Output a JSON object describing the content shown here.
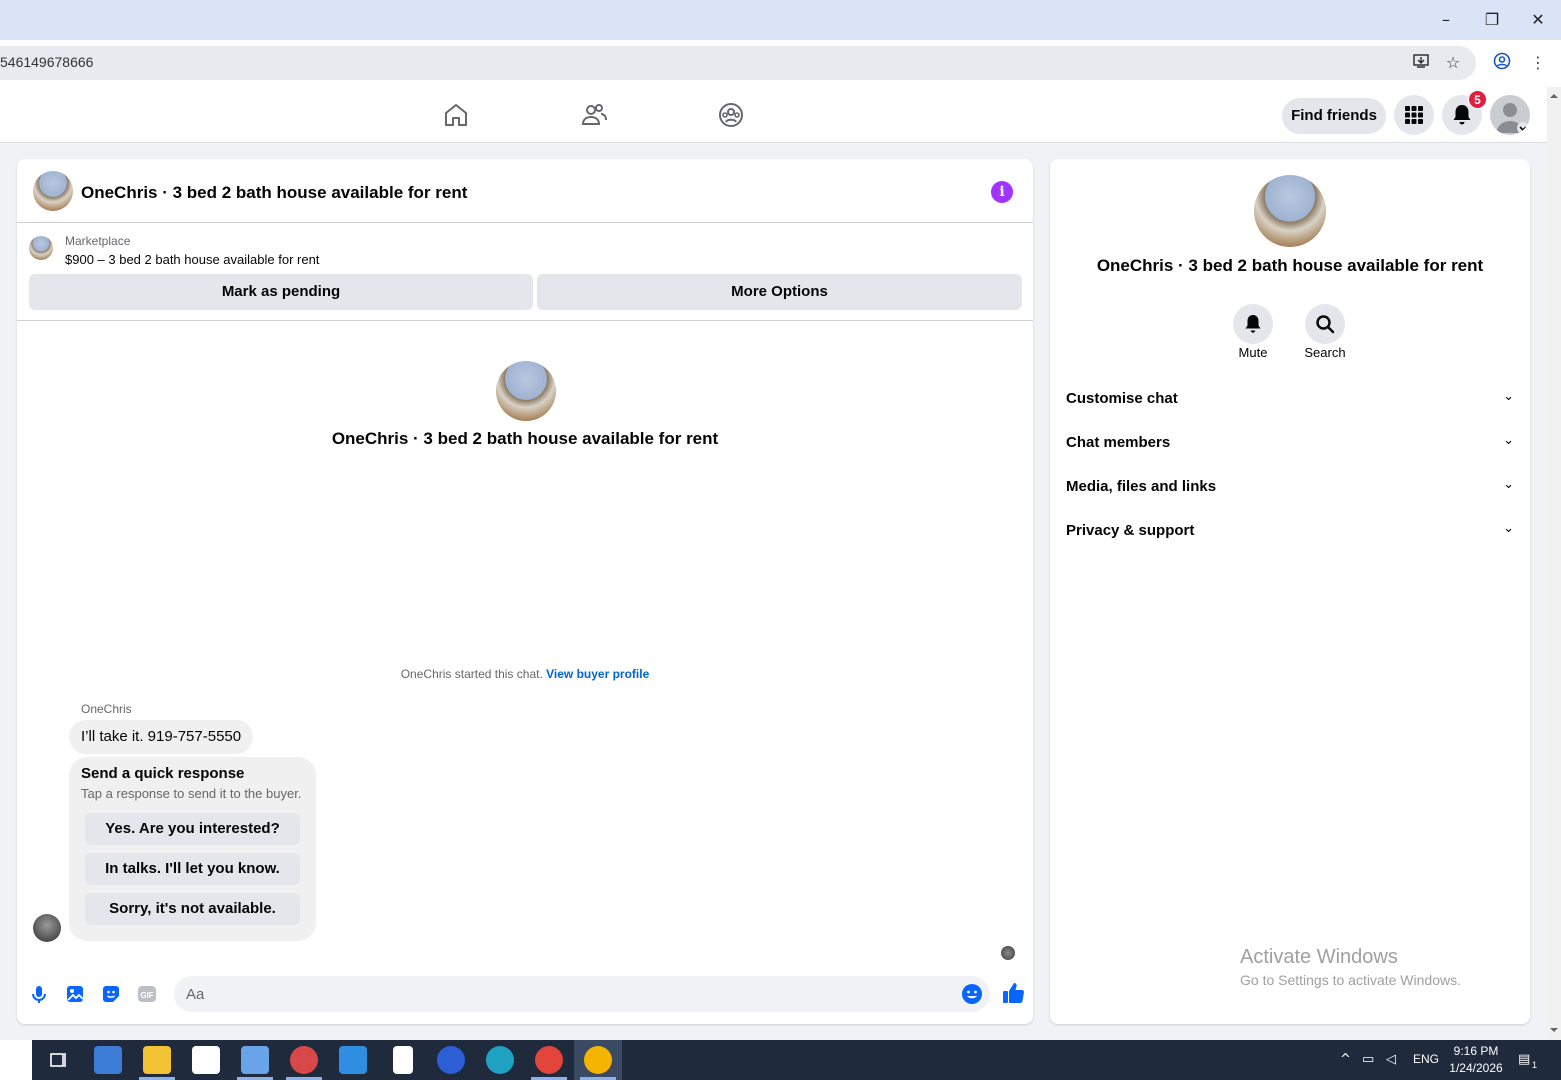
{
  "browser": {
    "url": "546149678666",
    "window_controls": {
      "minimize": "–",
      "restore": "❐",
      "close": "✕"
    }
  },
  "header": {
    "find_friends": "Find friends",
    "notification_count": "5"
  },
  "chat": {
    "title": "OneChris · 3 bed 2 bath house available for rent",
    "marketplace_label": "Marketplace",
    "listing": "$900 – 3 bed 2 bath house available for rent",
    "mark_pending": "Mark as pending",
    "more_options": "More Options",
    "center_title": "OneChris · 3 bed 2 bath house available for rent",
    "started_text": "OneChris started this chat.",
    "view_buyer_profile": "View buyer profile",
    "sender": "OneChris",
    "message": "I’ll take it. 919-757-5550",
    "quick_response": {
      "title": "Send a quick response",
      "subtitle": "Tap a response to send it to the buyer.",
      "options": [
        "Yes. Are you interested?",
        "In talks. I'll let you know.",
        "Sorry, it's not available."
      ]
    },
    "composer_placeholder": "Aa"
  },
  "info_panel": {
    "title": "OneChris · 3 bed 2 bath house available for rent",
    "mute": "Mute",
    "search": "Search",
    "sections": [
      "Customise chat",
      "Chat members",
      "Media, files and links",
      "Privacy & support"
    ]
  },
  "watermark": {
    "line1": "Activate Windows",
    "line2": "Go to Settings to activate Windows."
  },
  "taskbar": {
    "language": "ENG",
    "time": "9:16 PM",
    "date": "1/24/2026",
    "notification_count": "1"
  },
  "colors": {
    "fb_blue": "#0866ff",
    "messenger_purple": "#a033ff",
    "badge_red": "#e41e3f",
    "link_blue": "#0064d1"
  }
}
